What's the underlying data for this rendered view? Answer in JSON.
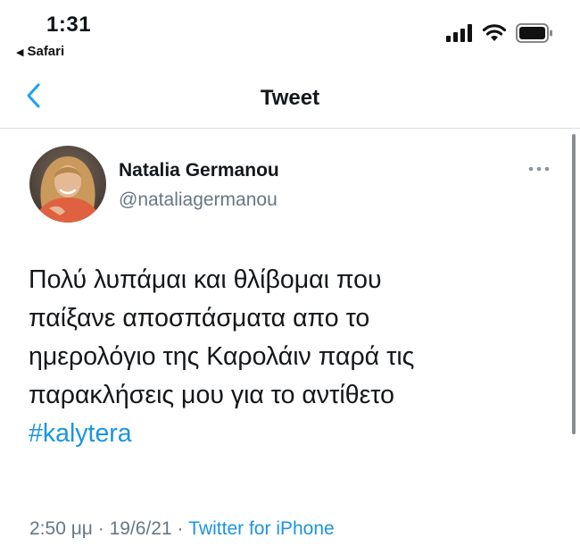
{
  "status_bar": {
    "time": "1:31",
    "back_app": "Safari",
    "back_icon": "back-triangle-icon",
    "icons": [
      "cellular-signal-icon",
      "wifi-icon",
      "battery-icon"
    ]
  },
  "nav": {
    "title": "Tweet",
    "back_icon": "chevron-left-icon"
  },
  "tweet": {
    "author_name": "Natalia Germanou",
    "author_handle": "@nataliagermanou",
    "text_lines": [
      "Πολύ λυπάμαι και θλίβομαι που",
      "παίξανε αποσπάσματα απο το",
      "ημερολόγιο της Καρολάιν παρά τις",
      "παρακλήσεις μου για το αντίθετο"
    ],
    "hashtag": "#kalytera",
    "timestamp": "2:50 μμ · 19/6/21 · ",
    "source": "Twitter for iPhone",
    "more_icon": "more-dots-icon"
  },
  "colors": {
    "link": "#1b95e0",
    "secondary_text": "#657786",
    "nav_accent": "#1da1f2"
  }
}
